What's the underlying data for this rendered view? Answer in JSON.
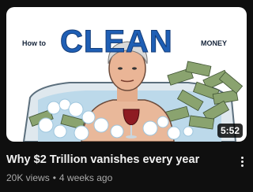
{
  "video": {
    "thumbnail": {
      "text_howto": "How to",
      "text_clean": "CLEAN",
      "text_money": "MONEY"
    },
    "duration": "5:52",
    "title": "Why $2 Trillion vanishes every year",
    "views": "20K views",
    "separator": "•",
    "age": "4 weeks ago"
  },
  "icons": {
    "menu": "more-vert-icon"
  }
}
